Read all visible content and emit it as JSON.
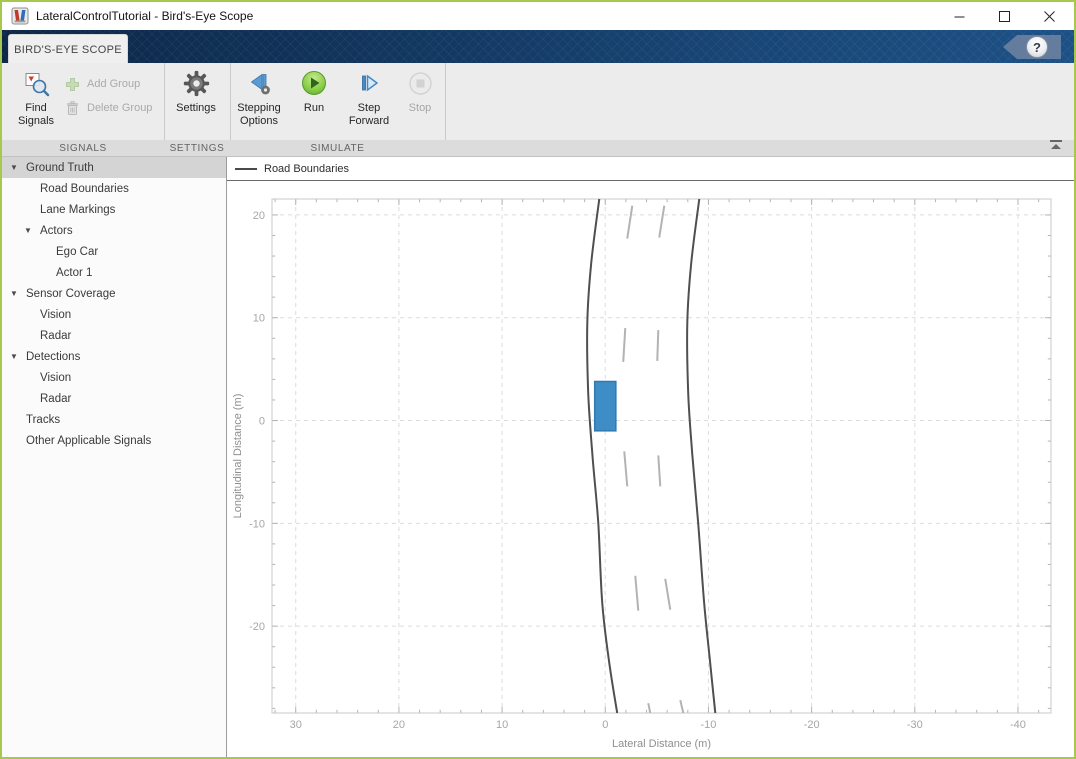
{
  "window": {
    "title": "LateralControlTutorial - Bird's-Eye Scope"
  },
  "tab": {
    "label": "BIRD'S-EYE SCOPE",
    "help": "?"
  },
  "toolbar": {
    "find_signals": "Find Signals",
    "add_group": "Add Group",
    "delete_group": "Delete Group",
    "settings": "Settings",
    "stepping_options": "Stepping Options",
    "run": "Run",
    "step_forward": "Step Forward",
    "stop": "Stop",
    "section_signals": "SIGNALS",
    "section_settings": "SETTINGS",
    "section_simulate": "SIMULATE"
  },
  "tree": {
    "items": [
      {
        "label": "Ground Truth",
        "level": 0,
        "arrow": true,
        "selected": true
      },
      {
        "label": "Road Boundaries",
        "level": 1,
        "arrow": false,
        "selected": false
      },
      {
        "label": "Lane Markings",
        "level": 1,
        "arrow": false,
        "selected": false
      },
      {
        "label": "Actors",
        "level": 1,
        "arrow": true,
        "selected": false
      },
      {
        "label": "Ego Car",
        "level": 2,
        "arrow": false,
        "selected": false
      },
      {
        "label": "Actor 1",
        "level": 2,
        "arrow": false,
        "selected": false
      },
      {
        "label": "Sensor Coverage",
        "level": 0,
        "arrow": true,
        "selected": false
      },
      {
        "label": "Vision",
        "level": 1,
        "arrow": false,
        "selected": false
      },
      {
        "label": "Radar",
        "level": 1,
        "arrow": false,
        "selected": false
      },
      {
        "label": "Detections",
        "level": 0,
        "arrow": true,
        "selected": false
      },
      {
        "label": "Vision",
        "level": 1,
        "arrow": false,
        "selected": false
      },
      {
        "label": "Radar",
        "level": 1,
        "arrow": false,
        "selected": false
      },
      {
        "label": "Tracks",
        "level": 0,
        "arrow": false,
        "selected": false
      },
      {
        "label": "Other Applicable Signals",
        "level": 0,
        "arrow": false,
        "selected": false
      }
    ]
  },
  "plot": {
    "legend_label": "Road Boundaries"
  },
  "chart_data": {
    "type": "line",
    "title": "",
    "xlabel": "Lateral Distance (m)",
    "ylabel": "Longitudinal Distance (m)",
    "x_reversed": true,
    "xlim": [
      32.3,
      -43.2
    ],
    "ylim": [
      -28.45,
      21.55
    ],
    "x_ticks": [
      30,
      20,
      10,
      0,
      -10,
      -20,
      -30,
      -40
    ],
    "y_ticks": [
      20,
      10,
      0,
      -10,
      -20
    ],
    "minor_tick_step": 2,
    "grid": "dashed",
    "legend": [
      {
        "label": "Road Boundaries",
        "color": "#4a4a4a"
      }
    ],
    "road_boundaries": {
      "color": "#4f4f4f",
      "left": [
        [
          0.58,
          21.55
        ],
        [
          1.36,
          15.3
        ],
        [
          1.74,
          9.5
        ],
        [
          1.65,
          2.7
        ],
        [
          1.26,
          -3.2
        ],
        [
          0.68,
          -10.0
        ],
        [
          0.29,
          -17.8
        ],
        [
          -0.39,
          -23.6
        ],
        [
          -1.16,
          -28.45
        ]
      ],
      "right": [
        [
          -9.11,
          21.55
        ],
        [
          -8.33,
          15.3
        ],
        [
          -7.95,
          9.5
        ],
        [
          -8.04,
          2.7
        ],
        [
          -8.43,
          -3.2
        ],
        [
          -9.01,
          -10.0
        ],
        [
          -9.59,
          -17.8
        ],
        [
          -10.17,
          -23.6
        ],
        [
          -10.66,
          -28.45
        ]
      ]
    },
    "lane_markings": {
      "color": "#b3b3b3",
      "segments": [
        [
          -2.62,
          20.9,
          -2.13,
          17.7
        ],
        [
          -5.72,
          20.9,
          -5.23,
          17.8
        ],
        [
          -1.94,
          9.0,
          -1.74,
          5.7
        ],
        [
          -5.14,
          8.8,
          -5.04,
          5.8
        ],
        [
          -1.84,
          -3.0,
          -2.13,
          -6.4
        ],
        [
          -5.14,
          -3.4,
          -5.33,
          -6.4
        ],
        [
          -2.91,
          -15.1,
          -3.2,
          -18.5
        ],
        [
          -5.81,
          -15.4,
          -6.3,
          -18.4
        ],
        [
          -4.17,
          -27.5,
          -4.36,
          -28.45
        ],
        [
          -7.27,
          -27.2,
          -7.56,
          -28.45
        ]
      ]
    },
    "ego_vehicle": {
      "center_lat": 0,
      "lon_rear": -1.0,
      "lon_front": 3.8,
      "width": 2.05,
      "fill": "#3e8dc6",
      "stroke": "#3379ad"
    }
  }
}
